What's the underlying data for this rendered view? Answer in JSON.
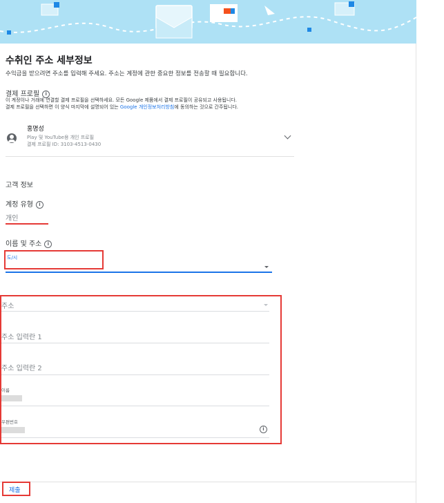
{
  "header": {
    "title": "수취인 주소 세부정보",
    "description": "수익금을 받으려면 주소를 입력해 주세요. 주소는 계정에 관한 중요한 정보를 전송할 때 필요합니다."
  },
  "payments_profile": {
    "label": "결제 프로필",
    "note_line1": "이 계정이나 거래에 연결할 결제 프로필을 선택하세요. 모든 Google 제품에서 결제 프로필이 공유되고 사용됩니다.",
    "note_line2_prefix": "결제 프로필을 선택하면 이 양식 마지막에 설명되어 있는 ",
    "note_line2_link": "Google 개인정보처리방침",
    "note_line2_suffix": "에 동의하는 것으로 간주됩니다.",
    "name": "홍명성",
    "type_line": "Play 및 YouTube용 개인 프로필",
    "id_line": "결제 프로필 ID: 3103-4513-0430"
  },
  "customer_info": {
    "heading": "고객 정보",
    "account_type_label": "계정 유형",
    "account_type_value": "개인",
    "name_address_label": "이름 및 주소",
    "city_label": "도/시"
  },
  "address_form": {
    "address_select": "주소",
    "address_line1": "주소 입력란 1",
    "address_line2": "주소 입력란 2",
    "name_label": "이름",
    "postal_label": "우편번호"
  },
  "footer": {
    "submit_label": "제출"
  },
  "colors": {
    "banner": "#aee1f5",
    "accent": "#1a73e8",
    "highlight_red": "#e53935"
  }
}
